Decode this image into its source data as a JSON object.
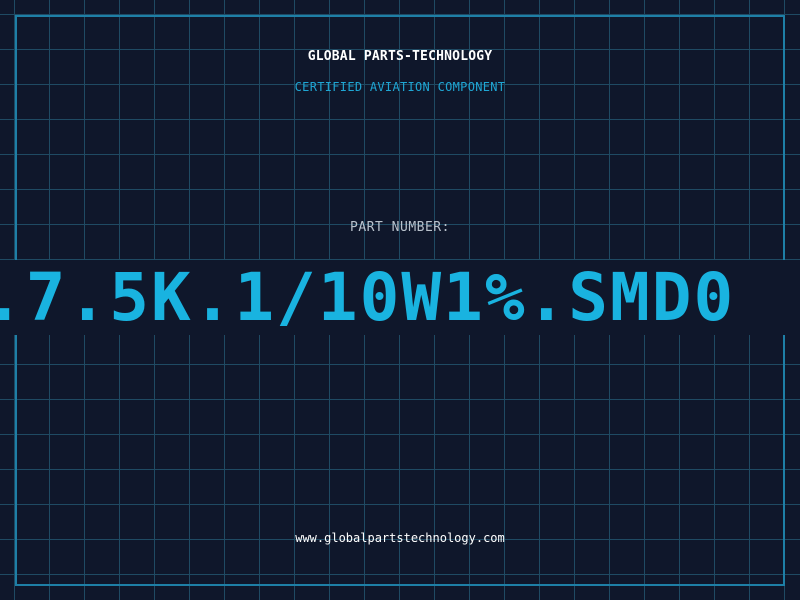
{
  "header": {
    "brand": "GLOBAL PARTS-TECHNOLOGY",
    "subtitle": "CERTIFIED AVIATION COMPONENT"
  },
  "part": {
    "label": "PART NUMBER:",
    "number": ".7.5K.1/10W1%.SMD0"
  },
  "footer": {
    "website": "www.globalpartstechnology.com"
  },
  "colors": {
    "background": "#0f172b",
    "grid": "#1f4a63",
    "frame": "#1e7fa6",
    "accent": "#19b3e0",
    "label": "#b9c2cc",
    "text": "#ffffff"
  }
}
